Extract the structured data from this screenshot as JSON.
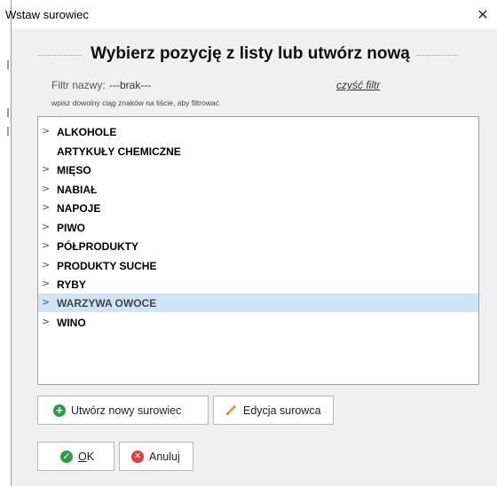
{
  "window": {
    "title": "Wstaw surowiec",
    "close_icon": "close-icon"
  },
  "header": {
    "title": "Wybierz pozycję z listy lub utwórz nową"
  },
  "filter": {
    "label": "Filtr nazwy:",
    "value": "---brak---",
    "clear_link": "czyść filtr",
    "hint": "wpisz dowolny ciąg znaków na liście, aby filtrować"
  },
  "tree": {
    "items": [
      {
        "label": "ALKOHOLE",
        "expandable": true,
        "selected": false
      },
      {
        "label": "ARTYKUŁY CHEMICZNE",
        "expandable": false,
        "selected": false
      },
      {
        "label": "MIĘSO",
        "expandable": true,
        "selected": false
      },
      {
        "label": "NABIAŁ",
        "expandable": true,
        "selected": false
      },
      {
        "label": "NAPOJE",
        "expandable": true,
        "selected": false
      },
      {
        "label": "PIWO",
        "expandable": true,
        "selected": false
      },
      {
        "label": "PÓŁPRODUKTY",
        "expandable": true,
        "selected": false
      },
      {
        "label": "PRODUKTY SUCHE",
        "expandable": true,
        "selected": false
      },
      {
        "label": "RYBY",
        "expandable": true,
        "selected": false
      },
      {
        "label": "WARZYWA OWOCE",
        "expandable": true,
        "selected": true
      },
      {
        "label": "WINO",
        "expandable": true,
        "selected": false
      }
    ]
  },
  "buttons": {
    "create": {
      "label": "Utwórz nowy surowiec",
      "icon": "plus-circle-icon"
    },
    "edit": {
      "label": "Edycja surowca",
      "icon": "pencil-icon"
    },
    "ok": {
      "label_underlined": "O",
      "label_rest": "K",
      "icon": "check-circle-icon"
    },
    "cancel": {
      "label": "Anuluj",
      "icon": "x-circle-icon"
    }
  },
  "colors": {
    "selection": "#cfe4f8",
    "green_icon": "#2e9e42",
    "red_icon": "#e23b3b"
  }
}
